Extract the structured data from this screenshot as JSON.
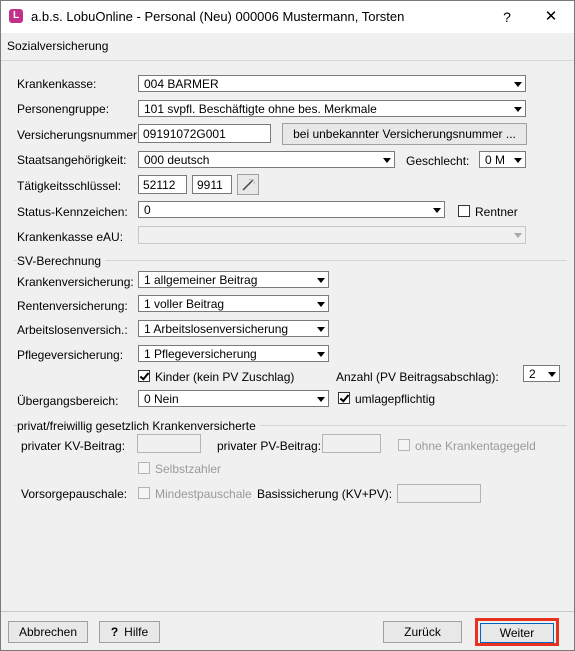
{
  "window": {
    "title": "a.b.s. LobuOnline - Personal (Neu) 000006 Mustermann, Torsten",
    "help_glyph": "?",
    "close_glyph": "✕",
    "app_icon_glyph": "L"
  },
  "section": {
    "title": "Sozialversicherung"
  },
  "fields": {
    "krankenkasse": {
      "label": "Krankenkasse:",
      "value": "004 BARMER"
    },
    "personengruppe": {
      "label": "Personengruppe:",
      "value": "101 svpfl. Beschäftigte ohne bes. Merkmale"
    },
    "versicherungsnummer": {
      "label": "Versicherungsnummer:",
      "value": "09191072G001",
      "button": "bei unbekannter Versicherungsnummer ..."
    },
    "staatsangehoerigkeit": {
      "label": "Staatsangehörigkeit:",
      "value": "000 deutsch"
    },
    "geschlecht": {
      "label": "Geschlecht:",
      "value": "0 M"
    },
    "taetigkeitsschluessel": {
      "label": "Tätigkeitsschlüssel:",
      "value1": "52112",
      "value2": "9911"
    },
    "status_kennzeichen": {
      "label": "Status-Kennzeichen:",
      "value": "0"
    },
    "rentner": {
      "label": "Rentner",
      "checked": false
    },
    "krankenkasse_eau": {
      "label": "Krankenkasse eAU:",
      "value": ""
    }
  },
  "sv_berechnung": {
    "title": "SV-Berechnung",
    "krankenversicherung": {
      "label": "Krankenversicherung:",
      "value": "1 allgemeiner Beitrag"
    },
    "rentenversicherung": {
      "label": "Rentenversicherung:",
      "value": "1 voller Beitrag"
    },
    "arbeitslosenversicherung": {
      "label": "Arbeitslosenversich.:",
      "value": "1 Arbeitslosenversicherung"
    },
    "pflegeversicherung": {
      "label": "Pflegeversicherung:",
      "value": "1 Pflegeversicherung"
    },
    "kinder": {
      "label": "Kinder (kein PV Zuschlag)",
      "checked": true
    },
    "anzahl": {
      "label": "Anzahl (PV Beitragsabschlag):",
      "value": "2"
    },
    "uebergangsbereich": {
      "label": "Übergangsbereich:",
      "value": "0 Nein"
    },
    "umlagepflichtig": {
      "label": "umlagepflichtig",
      "checked": true
    }
  },
  "privat": {
    "title": "privat/freiwillig gesetzlich Krankenversicherte",
    "kv_beitrag": {
      "label": "privater KV-Beitrag:",
      "value": ""
    },
    "pv_beitrag": {
      "label": "privater PV-Beitrag:",
      "value": ""
    },
    "ohne_krankentagegeld": {
      "label": "ohne Krankentagegeld",
      "checked": false
    },
    "selbstzahler": {
      "label": "Selbstzahler",
      "checked": false
    },
    "vorsorgepauschale": {
      "label": "Vorsorgepauschale:"
    },
    "mindestpauschale": {
      "label": "Mindestpauschale",
      "checked": false
    },
    "basissicherung": {
      "label": "Basissicherung (KV+PV):",
      "value": ""
    }
  },
  "footer": {
    "abbrechen": "Abbrechen",
    "hilfe": "Hilfe",
    "hilfe_icon": "?",
    "zurueck": "Zurück",
    "weiter": "Weiter"
  },
  "colors": {
    "highlight": "#e8321e",
    "app_icon": "#c0328a"
  }
}
